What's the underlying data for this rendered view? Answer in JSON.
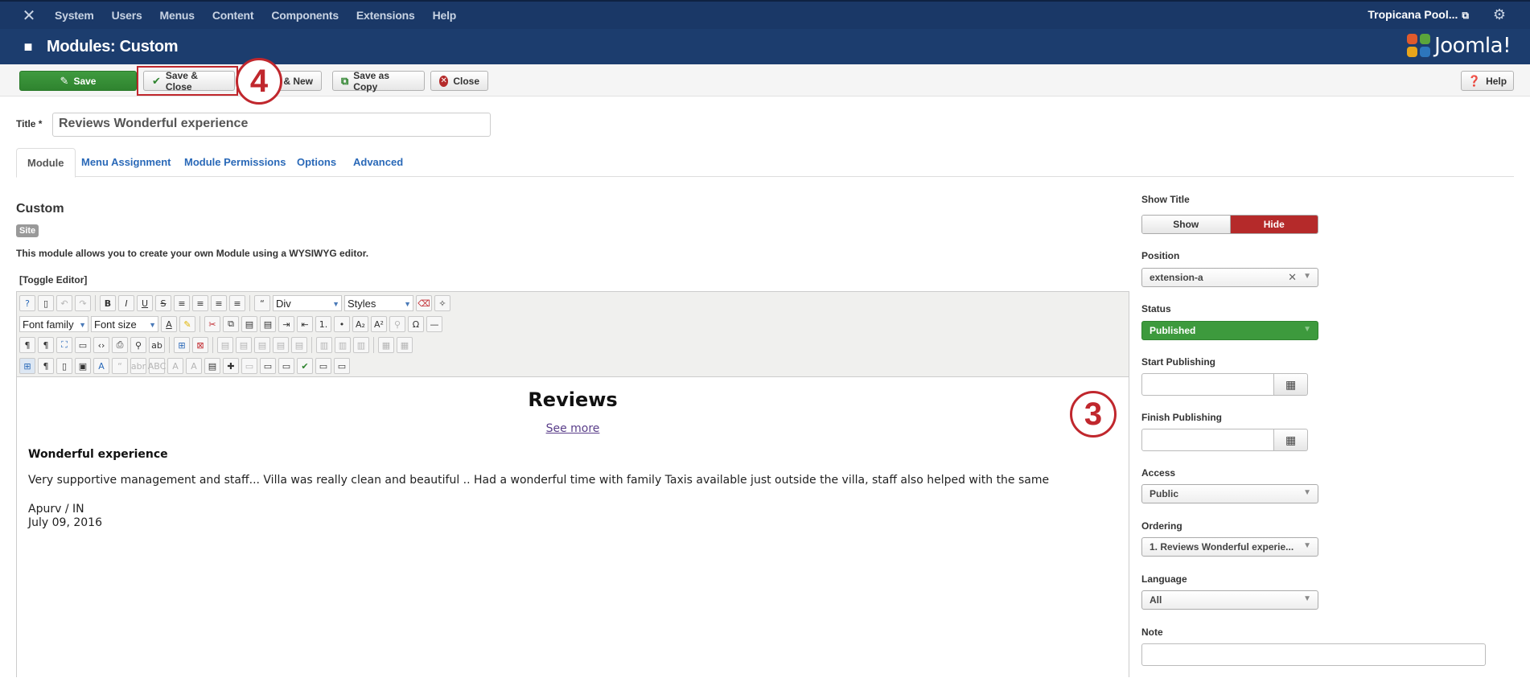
{
  "topbar": {
    "menu": [
      "System",
      "Users",
      "Menus",
      "Content",
      "Components",
      "Extensions",
      "Help"
    ],
    "site_name": "Tropicana Pool..."
  },
  "header": {
    "title": "Modules: Custom",
    "logo_text": "Joomla!"
  },
  "toolbar": {
    "save": "Save",
    "save_close": "Save & Close",
    "save_new": "& New",
    "save_copy": "Save as Copy",
    "close": "Close",
    "help": "Help"
  },
  "annotations": {
    "step_4": "4",
    "step_3": "3"
  },
  "form": {
    "title_label": "Title *",
    "title_value": "Reviews Wonderful experience"
  },
  "tabs": [
    "Module",
    "Menu Assignment",
    "Module Permissions",
    "Options",
    "Advanced"
  ],
  "module": {
    "name": "Custom",
    "badge": "Site",
    "description": "This module allows you to create your own Module using a WYSIWYG editor.",
    "toggle_editor": "[Toggle Editor]"
  },
  "editor": {
    "format_select": "Div",
    "styles_select": "Styles",
    "font_family": "Font family",
    "font_size": "Font size",
    "content": {
      "heading": "Reviews",
      "link": "See more",
      "subheading": "Wonderful experience",
      "text": "Very supportive management and staff... Villa was really clean and beautiful .. Had a wonderful time with family Taxis available just outside the villa, staff also helped with the same",
      "author": "Apurv / IN",
      "date": "July 09, 2016"
    }
  },
  "sidebar": {
    "show_title_label": "Show Title",
    "show_label": "Show",
    "hide_label": "Hide",
    "position_label": "Position",
    "position_value": "extension-a",
    "status_label": "Status",
    "status_value": "Published",
    "start_publishing_label": "Start Publishing",
    "finish_publishing_label": "Finish Publishing",
    "access_label": "Access",
    "access_value": "Public",
    "ordering_label": "Ordering",
    "ordering_value": "1. Reviews Wonderful experie...",
    "language_label": "Language",
    "language_value": "All",
    "note_label": "Note"
  },
  "colors": {
    "topbar": "#1a3867",
    "header": "#1c3d6e",
    "save_green": "#3f9b3f",
    "hide_red": "#b52a2a",
    "link_blue": "#2a69b8",
    "annotation_red": "#c0272d"
  }
}
